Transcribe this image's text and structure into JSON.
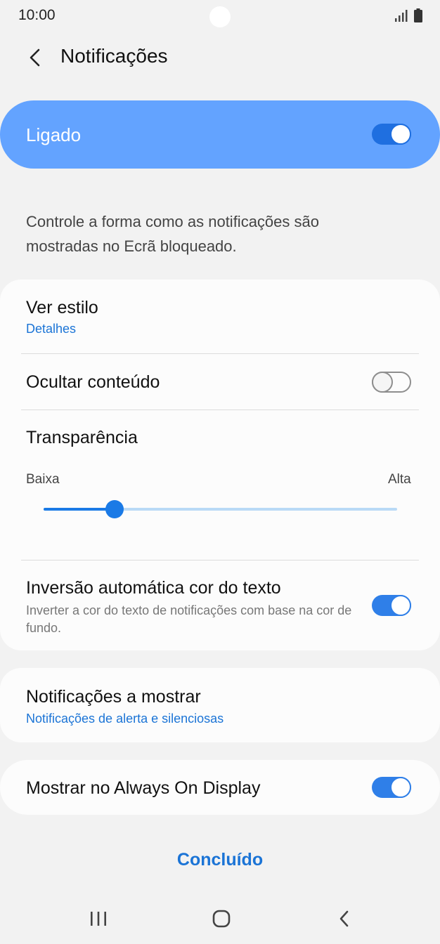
{
  "status_bar": {
    "time": "10:00",
    "icons": [
      "signal-icon",
      "battery-icon"
    ]
  },
  "header": {
    "back_icon": "chevron-left-icon",
    "title": "Notificações"
  },
  "master": {
    "label": "Ligado",
    "on": true
  },
  "description": "Controle a forma como as notificações são mostradas no Ecrã bloqueado.",
  "settings": {
    "view_style": {
      "title": "Ver estilo",
      "value": "Detalhes"
    },
    "hide_content": {
      "title": "Ocultar conteúdo",
      "on": false
    },
    "transparency": {
      "title": "Transparência",
      "min_label": "Baixa",
      "max_label": "Alta",
      "level": 0.2
    },
    "auto_invert": {
      "title": "Inversão automática cor do texto",
      "subtitle": "Inverter a cor do texto de notificações com base na cor de fundo.",
      "on": true
    }
  },
  "notifications_to_show": {
    "title": "Notificações a mostrar",
    "value": "Notificações de alerta e silenciosas"
  },
  "always_on": {
    "title": "Mostrar no Always On Display",
    "on": true
  },
  "done_label": "Concluído",
  "nav_bar": {
    "icons": [
      "recents-icon",
      "home-icon",
      "back-icon"
    ]
  },
  "colors": {
    "accent": "#1a7ae6",
    "highlight": "#63a3ff",
    "link": "#1b74d6"
  }
}
